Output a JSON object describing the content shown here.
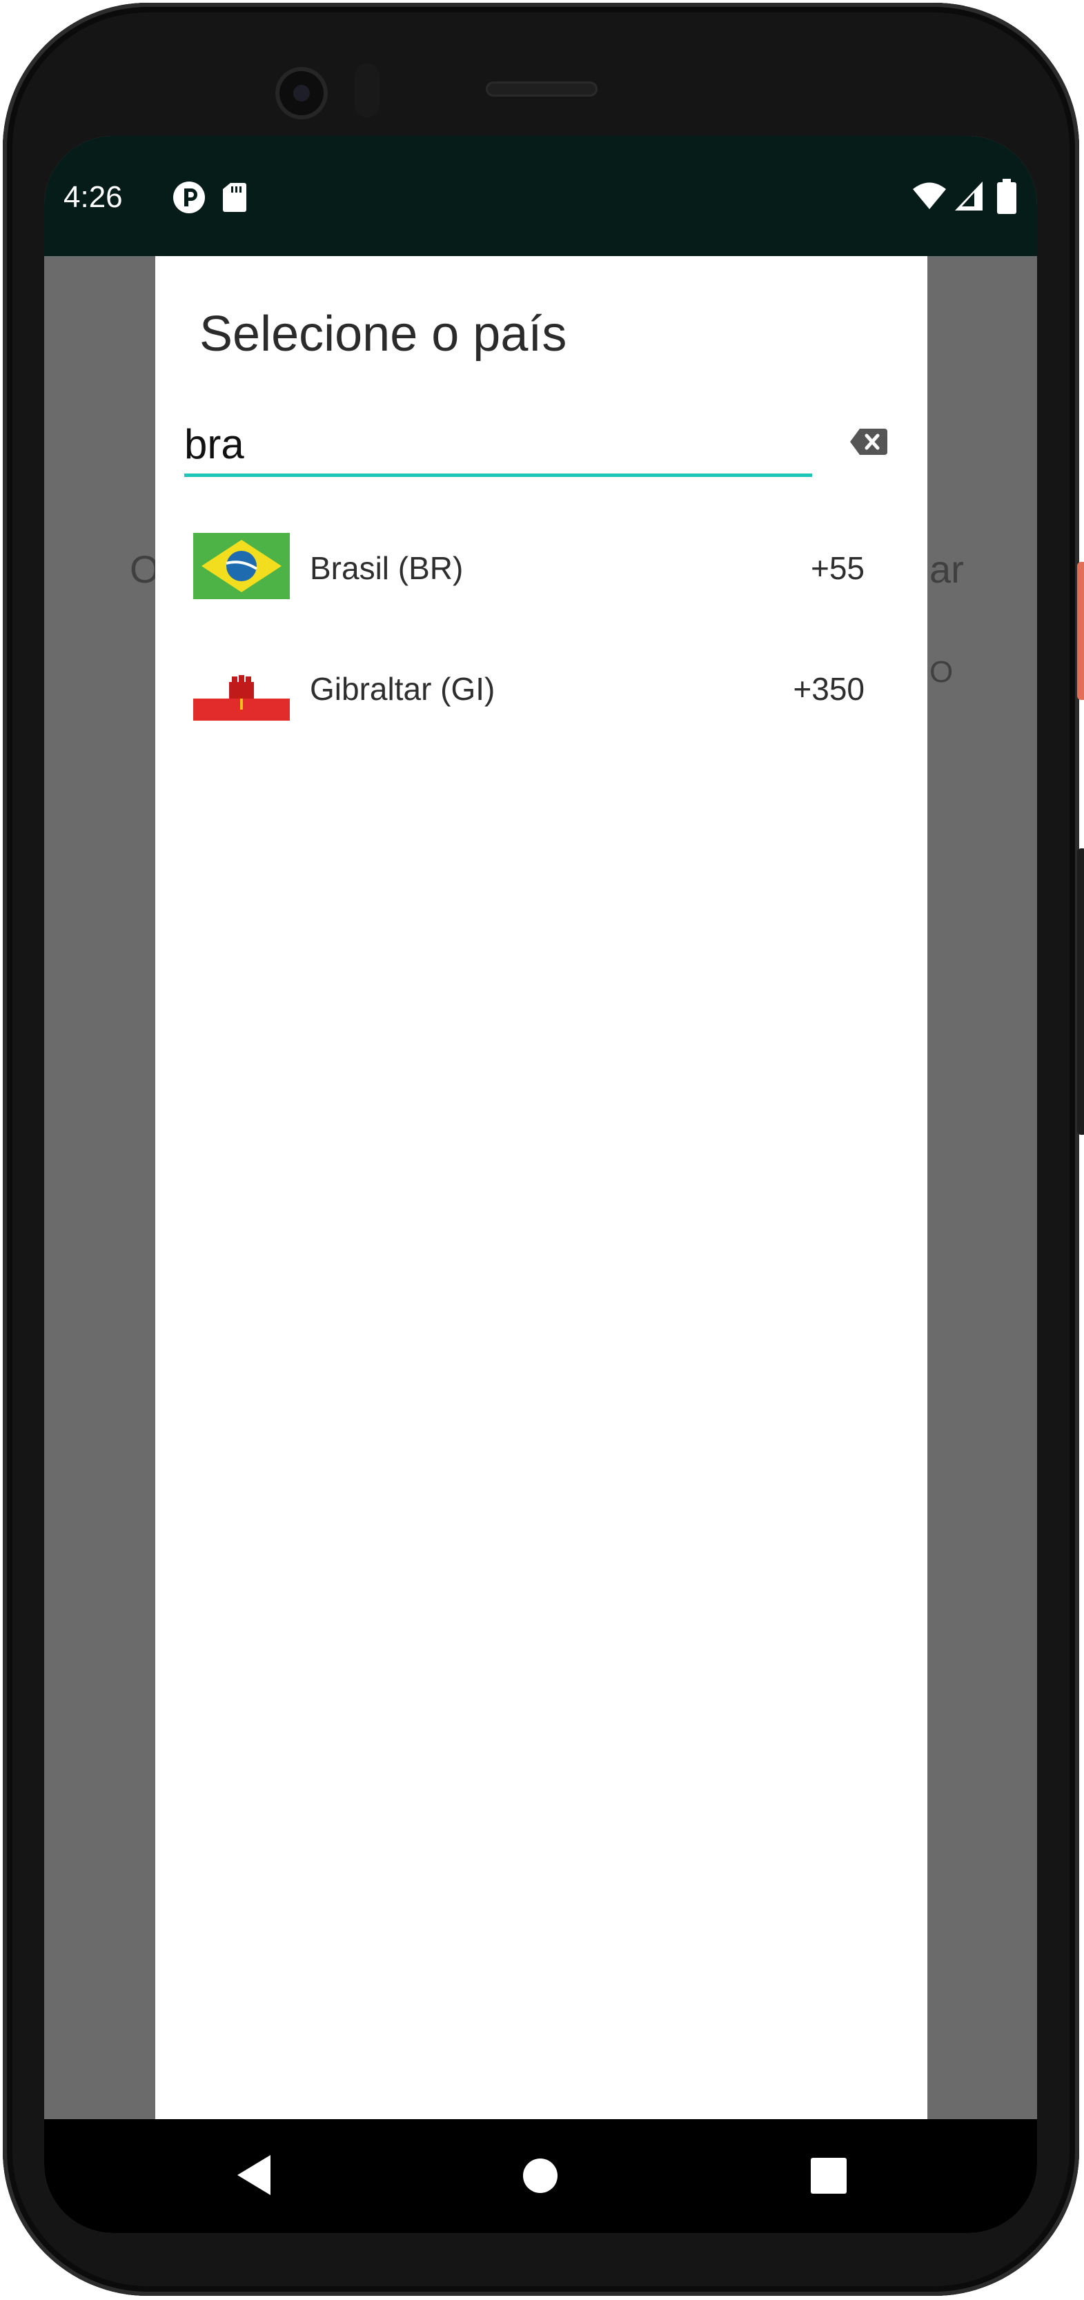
{
  "status_bar": {
    "time": "4:26",
    "left_icons": [
      "app-notification-icon",
      "sd-card-icon"
    ],
    "right_icons": [
      "wifi-icon",
      "cellular-signal-icon",
      "battery-icon"
    ],
    "background_color": "#051c18"
  },
  "background_screen": {
    "left_fragment": "O",
    "right_fragment": "ar",
    "right_fragment_2": "O"
  },
  "country_dialog": {
    "title": "Selecione o país",
    "search": {
      "value": "bra",
      "underline_color": "#1cc7b7",
      "clear_icon": "backspace-clear-icon"
    },
    "countries": [
      {
        "name": "Brasil (BR)",
        "dial_code": "+55",
        "flag_icon": "brazil-flag-icon"
      },
      {
        "name": "Gibraltar (GI)",
        "dial_code": "+350",
        "flag_icon": "gibraltar-flag-icon"
      }
    ]
  },
  "navigation_bar": {
    "buttons": [
      "back-icon",
      "home-icon",
      "recents-icon"
    ]
  }
}
